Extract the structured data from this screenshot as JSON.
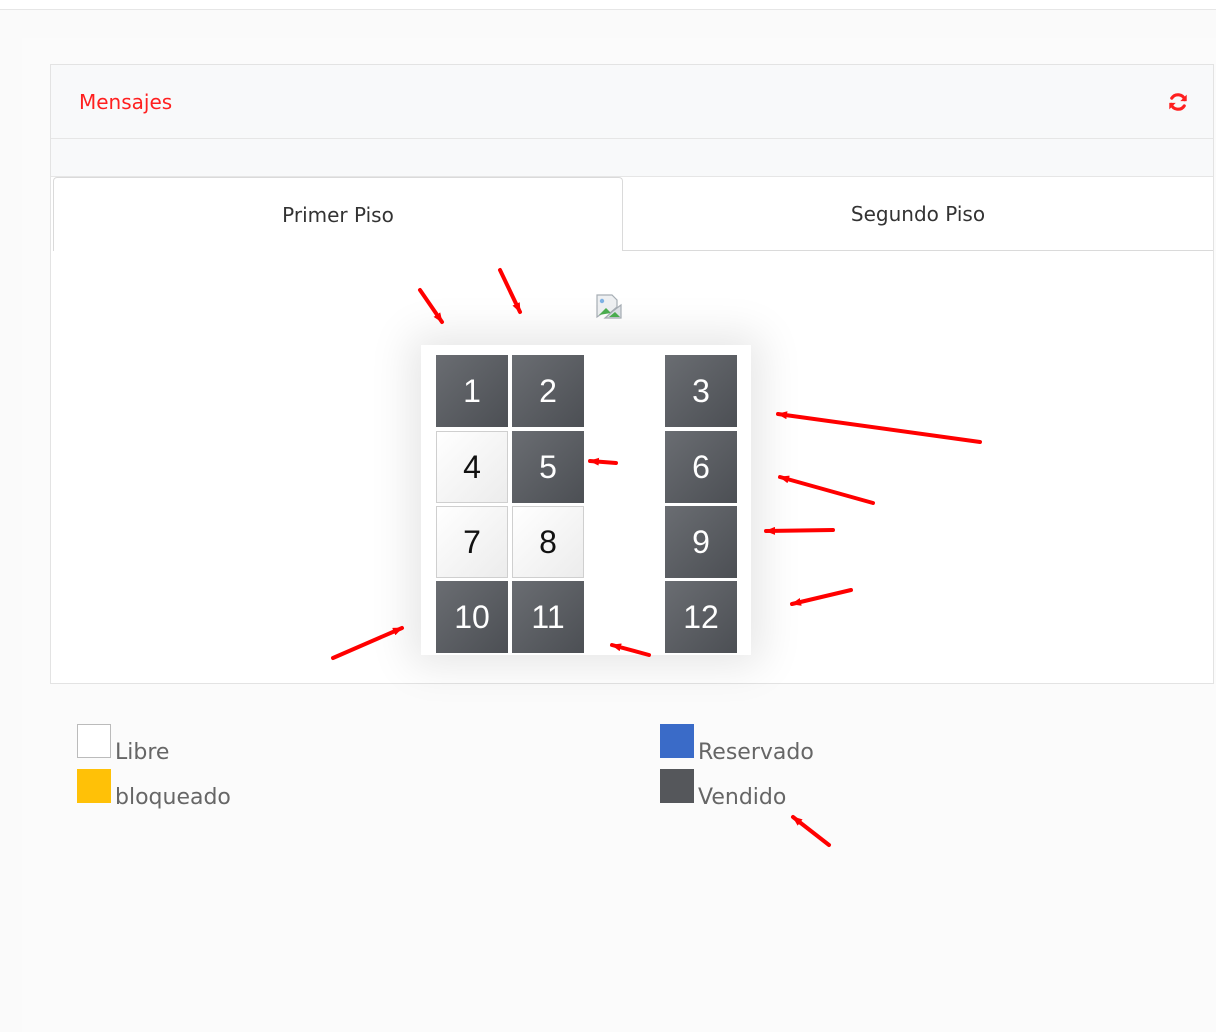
{
  "panel": {
    "title": "Mensajes",
    "title_color": "#ff1f1f",
    "refresh_icon": "refresh-icon"
  },
  "tabs": [
    {
      "label": "Primer Piso",
      "active": true
    },
    {
      "label": "Segundo Piso",
      "active": false
    }
  ],
  "broken_image_icon": "broken-image-icon",
  "seats": [
    {
      "number": "1",
      "status": "Vendido"
    },
    {
      "number": "2",
      "status": "Vendido"
    },
    {
      "number": "3",
      "status": "Vendido"
    },
    {
      "number": "4",
      "status": "Libre"
    },
    {
      "number": "5",
      "status": "Vendido"
    },
    {
      "number": "6",
      "status": "Vendido"
    },
    {
      "number": "7",
      "status": "Libre"
    },
    {
      "number": "8",
      "status": "Libre"
    },
    {
      "number": "9",
      "status": "Vendido"
    },
    {
      "number": "10",
      "status": "Vendido"
    },
    {
      "number": "11",
      "status": "Vendido"
    },
    {
      "number": "12",
      "status": "Vendido"
    }
  ],
  "legend": [
    {
      "label": "Libre",
      "color": "#ffffff"
    },
    {
      "label": "bloqueado",
      "color": "#ffc107"
    },
    {
      "label": "Reservado",
      "color": "#3a6bc8"
    },
    {
      "label": "Vendido",
      "color": "#55575b"
    }
  ],
  "annotation_arrow_color": "#ff0000"
}
